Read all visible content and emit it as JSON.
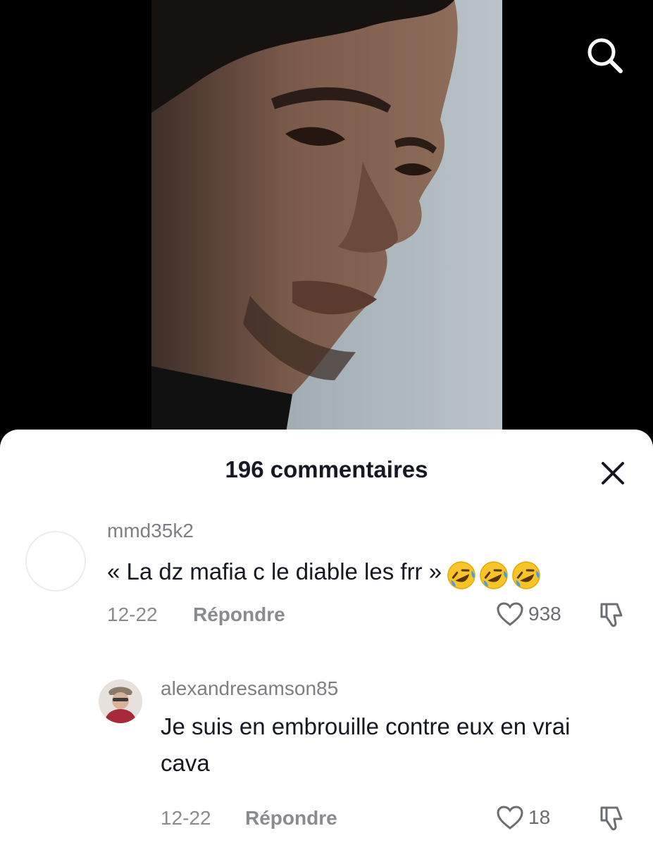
{
  "header": {
    "search_icon": "search-icon"
  },
  "comments_sheet": {
    "title": "196 commentaires",
    "close_icon": "close-icon",
    "comments": [
      {
        "username": "mmd35k2",
        "text": "« La dz mafia c le diable les frr »",
        "emoji": "rolling-on-the-floor-laughing x3",
        "date": "12-22",
        "reply_label": "Répondre",
        "likes": "938"
      },
      {
        "username": "alexandresamson85",
        "text": "Je suis en embrouille contre eux en vrai cava",
        "date": "12-22",
        "reply_label": "Répondre",
        "likes": "18"
      }
    ]
  },
  "colors": {
    "sheet_bg": "#ffffff",
    "text_primary": "#161823",
    "text_secondary": "#8a8b91",
    "page_bg": "#000000"
  }
}
